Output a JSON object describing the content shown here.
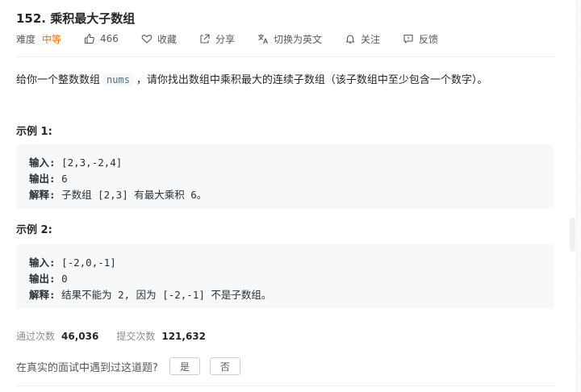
{
  "problem": {
    "title": "152. 乘积最大子数组",
    "difficulty_label": "难度",
    "difficulty": "中等",
    "likes": "466",
    "actions": {
      "favorite": "收藏",
      "share": "分享",
      "switch_lang": "切换为英文",
      "follow": "关注",
      "feedback": "反馈"
    },
    "description": {
      "before": "给你一个整数数组",
      "code": "nums",
      "after": "，请你找出数组中乘积最大的连续子数组（该子数组中至少包含一个数字）。"
    }
  },
  "examples": [
    {
      "title": "示例 1:",
      "input_label": "输入:",
      "input_value": "[2,3,-2,4]",
      "output_label": "输出:",
      "output_value": "6",
      "explain_label": "解释:",
      "explain_value": "子数组 [2,3] 有最大乘积 6。"
    },
    {
      "title": "示例 2:",
      "input_label": "输入:",
      "input_value": "[-2,0,-1]",
      "output_label": "输出:",
      "output_value": "0",
      "explain_label": "解释:",
      "explain_value": "结果不能为 2, 因为 [-2,-1] 不是子数组。"
    }
  ],
  "stats": {
    "accepted_label": "通过次数",
    "accepted_value": "46,036",
    "submissions_label": "提交次数",
    "submissions_value": "121,632"
  },
  "interview": {
    "question": "在真实的面试中遇到过这道题?",
    "yes": "是",
    "no": "否"
  },
  "colors": {
    "difficulty_medium": "#ef6c00",
    "code_bg": "#f7f8fa"
  }
}
